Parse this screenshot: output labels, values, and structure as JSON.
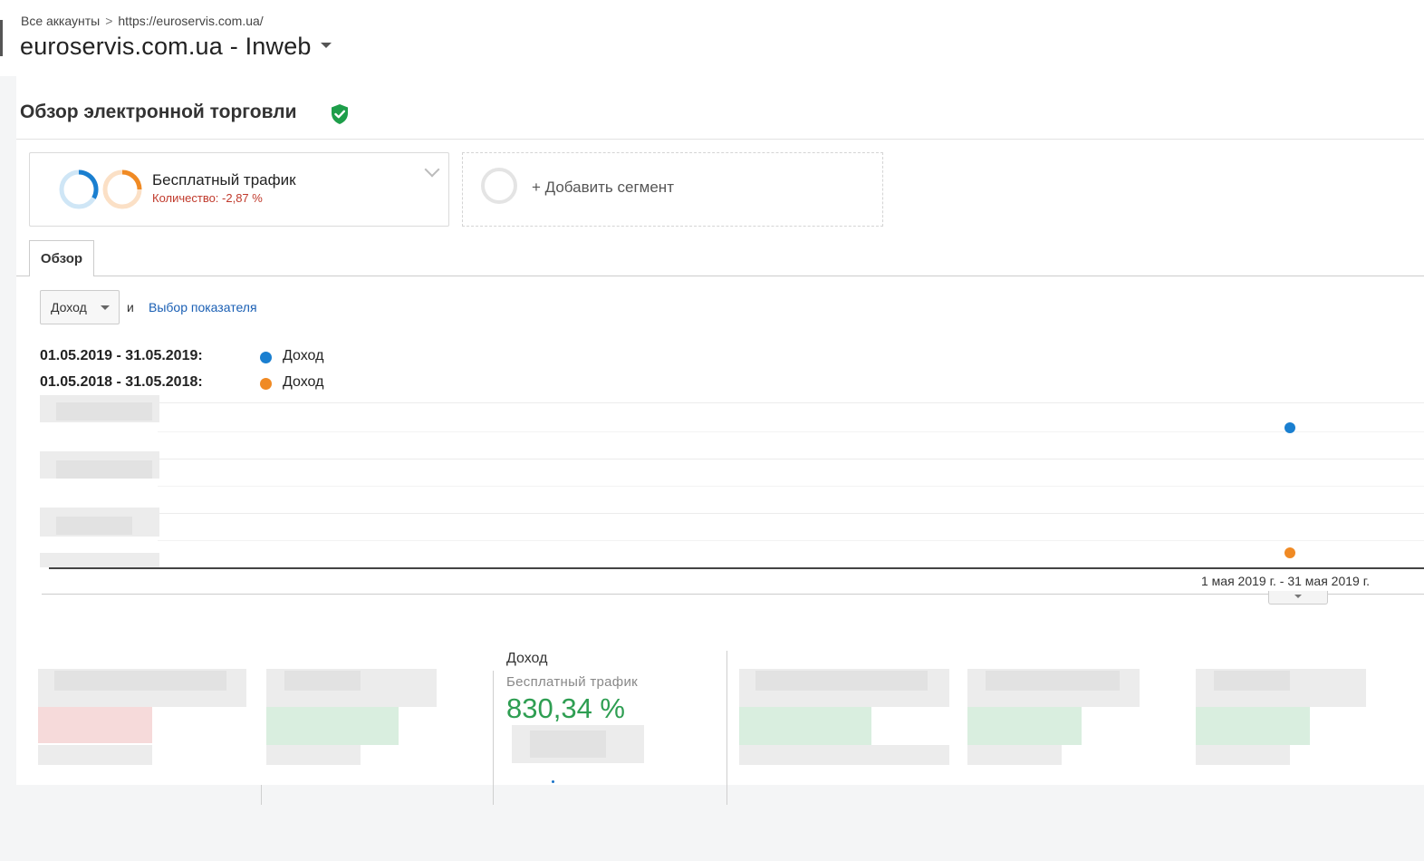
{
  "header": {
    "breadcrumb": [
      "Все аккаунты",
      "https://euroservis.com.ua/"
    ],
    "breadcrumb_separator": ">",
    "property_title": "euroservis.com.ua - Inweb"
  },
  "report": {
    "title": "Обзор электронной торговли",
    "verified_icon": "shield-check-icon"
  },
  "segments": {
    "active": {
      "name": "Бесплатный трафик",
      "sub": "Количество: -2,87 %"
    },
    "add_label": "+ Добавить сегмент"
  },
  "tabs": [
    "Обзор"
  ],
  "metric_selector": {
    "selected": "Доход",
    "and": "и",
    "link": "Выбор показателя"
  },
  "legend": [
    {
      "range": "01.05.2019 - 31.05.2019:",
      "name": "Доход",
      "color": "#1a7fd0"
    },
    {
      "range": "01.05.2018 - 31.05.2018:",
      "name": "Доход",
      "color": "#f08a24"
    }
  ],
  "chart_data": {
    "type": "scatter",
    "x": [
      "1 мая 2019 г. - 31 мая 2019 г."
    ],
    "series": [
      {
        "name": "01.05.2019 - 31.05.2019: Доход",
        "values": [
          1
        ],
        "color": "#1a7fd0"
      },
      {
        "name": "01.05.2018 - 31.05.2018: Доход",
        "values": [
          0
        ],
        "color": "#f08a24"
      }
    ],
    "x_tick_labels": [
      "1 мая 2019 г. - 31 мая 2019 г."
    ],
    "ylabel": "",
    "grid": true
  },
  "scorecard": {
    "title": "Доход",
    "segment": "Бесплатный трафик",
    "value": "830,34 %",
    "value_color": "#2e9e52"
  }
}
